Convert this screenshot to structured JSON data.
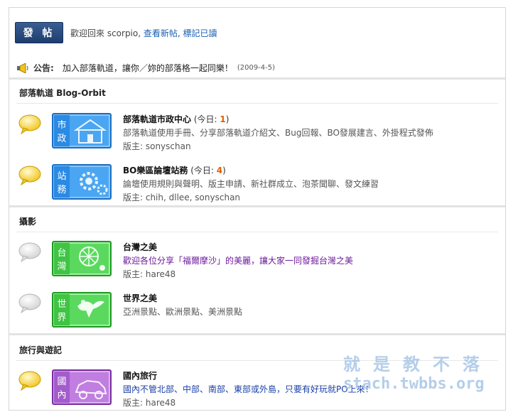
{
  "header": {
    "post_button": "發 帖",
    "welcome_prefix": "歡迎回來 scorpio, ",
    "view_new_posts": "查看新帖",
    "separator": ", ",
    "mark_read": "標記已讀"
  },
  "announcement": {
    "label": "公告:",
    "text": "加入部落軌道，讓你／妳的部落格一起同樂！",
    "date": "(2009-4-5)"
  },
  "categories": [
    {
      "title": "部落軌道 Blog-Orbit",
      "forums": [
        {
          "name": "部落軌道市政中心",
          "today_label": "(今日: ",
          "today_count": "1",
          "today_close": ")",
          "description": "部落軌道使用手冊、分享部落軌道介紹文、Bug回報、BO發展建言、外掛程式發佈",
          "moderators": "版主: sonyschan",
          "icon_text": [
            "市",
            "政"
          ],
          "icon_color": "#2f8fe6",
          "bubble": "yellow"
        },
        {
          "name": "BO樂區論壇站務",
          "today_label": "(今日: ",
          "today_count": "4",
          "today_close": ")",
          "description": "論壇使用規則與聲明、版主申請、新社群成立、泡茶聞聊、發文練習",
          "moderators": "版主: chih, dllee, sonyschan",
          "icon_text": [
            "站",
            "務"
          ],
          "icon_color": "#2f8fe6",
          "bubble": "yellow"
        }
      ]
    },
    {
      "title": "攝影",
      "forums": [
        {
          "name": "台灣之美",
          "description": "歡迎各位分享「福爾摩沙」的美麗，讓大家一同發掘台灣之美",
          "moderators": "版主: hare48",
          "icon_text": [
            "台",
            "灣"
          ],
          "icon_color": "#36c23a",
          "bubble": "gray"
        },
        {
          "name": "世界之美",
          "description": "亞洲景點、歐洲景點、美洲景點",
          "moderators": "",
          "icon_text": [
            "世",
            "界"
          ],
          "icon_color": "#36c23a",
          "bubble": "gray"
        }
      ]
    },
    {
      "title": "旅行與遊記",
      "forums": [
        {
          "name": "國內旅行",
          "description": "國內不管北部、中部、南部、東部或外島，只要有好玩就PO上來！",
          "moderators": "版主: hare48",
          "icon_text": [
            "國",
            "內"
          ],
          "icon_color": "#a455c8",
          "bubble": "yellow"
        }
      ]
    }
  ],
  "watermark": {
    "line1": "就是教不落",
    "line2": "stach.twbbs.org"
  },
  "colors": {
    "accent": "#1a60b3",
    "today_count": "#e55c00",
    "blue_icon": "#2f8fe6",
    "green_icon": "#36c23a",
    "purple_icon": "#a455c8"
  }
}
